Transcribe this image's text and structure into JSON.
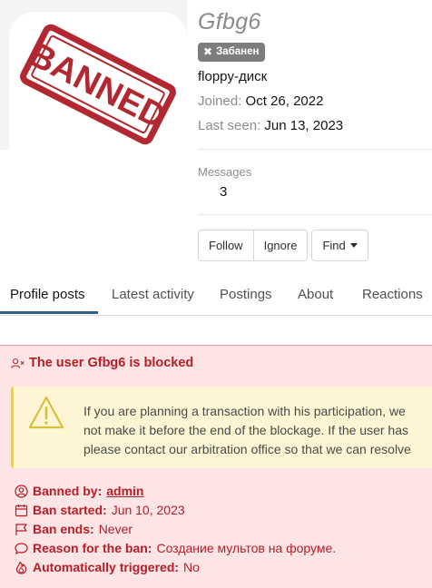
{
  "profile": {
    "username": "Gfbg6",
    "badge": "Забанен",
    "user_title": "floppy-диск",
    "joined_label": "Joined:",
    "joined_value": "Oct 26, 2022",
    "last_seen_label": "Last seen:",
    "last_seen_value": "Jun 13, 2023",
    "avatar_stamp_text": "BANNED"
  },
  "stats": {
    "messages_label": "Messages",
    "messages_value": "3"
  },
  "actions": {
    "follow": "Follow",
    "ignore": "Ignore",
    "find": "Find"
  },
  "tabs": [
    {
      "label": "Profile posts",
      "active": true
    },
    {
      "label": "Latest activity"
    },
    {
      "label": "Postings"
    },
    {
      "label": "About"
    },
    {
      "label": "Reactions"
    }
  ],
  "ban_notice": {
    "title": "The user Gfbg6 is blocked",
    "warning_lines": [
      "If you are planning a transaction with his participation, we",
      "not make it before the end of the blockage. If the user has",
      "please contact our arbitration office so that we can resolve"
    ],
    "details": {
      "banned_by_label": "Banned by:",
      "banned_by_value": "admin",
      "ban_started_label": "Ban started:",
      "ban_started_value": "Jun 10, 2023",
      "ban_ends_label": "Ban ends:",
      "ban_ends_value": "Never",
      "reason_label": "Reason for the ban:",
      "reason_value": "Создание мультов на форуме.",
      "auto_label": "Automatically triggered:",
      "auto_value": "No"
    }
  },
  "colors": {
    "ban_red": "#b81d28",
    "ban_panel_bg": "#fde4e5",
    "warning_bg": "#fdf5d3",
    "tab_accent": "#2f5f8a",
    "badge_bg": "#7d7d7d"
  }
}
